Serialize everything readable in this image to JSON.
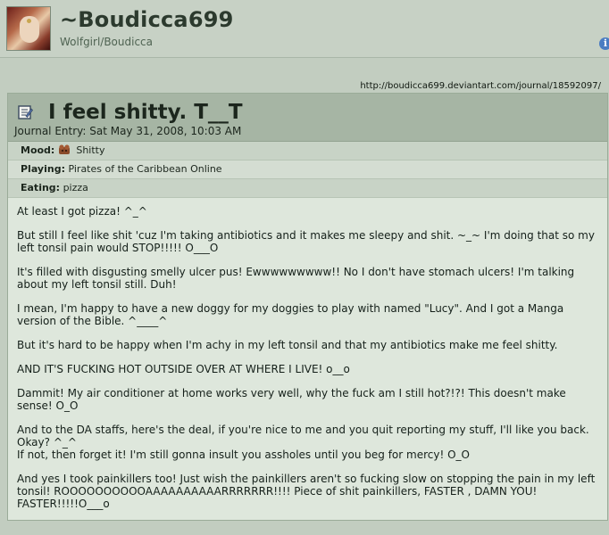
{
  "deviant": {
    "name": "~Boudicca699",
    "tagline": "Wolfgirl/Boudicca"
  },
  "journal": {
    "url": "http://boudicca699.deviantart.com/journal/18592097/",
    "title": "I feel shitty. T__T",
    "date": "Journal Entry: Sat May 31, 2008, 10:03 AM",
    "meta": {
      "mood_label": "Mood:",
      "mood_value": "Shitty",
      "playing_label": "Playing:",
      "playing_value": "Pirates of the Caribbean Online",
      "eating_label": "Eating:",
      "eating_value": "pizza"
    },
    "paragraphs": [
      "At least I got pizza! ^_^",
      "But still I feel like shit 'cuz I'm taking antibiotics and it makes me sleepy and shit. ~_~ I'm doing that so my left tonsil pain would STOP!!!!! O___O",
      "It's filled with disgusting smelly ulcer pus! Ewwwwwwwww!! No I don't have stomach ulcers! I'm talking about my left tonsil still. Duh!",
      "I mean, I'm happy to have a new doggy for my doggies to play with named \"Lucy\". And I got a Manga version of the Bible. ^____^",
      "But it's hard to be happy when I'm achy in my left tonsil and that my antibiotics make me feel shitty.",
      "AND IT'S FUCKING HOT OUTSIDE OVER AT WHERE I LIVE! o__o",
      "Dammit! My air conditioner at home works very well, why the fuck am I still hot?!?! This doesn't make sense! O_O",
      "And to the DA staffs, here's the deal, if you're nice to me and you quit reporting my stuff, I'll like you back. Okay? ^_^\nIf not, then forget it! I'm still gonna insult you assholes until you beg for mercy! O_O",
      "And yes I took painkillers too! Just wish the painkillers aren't so fucking slow on stopping the pain in my left tonsil! ROOOOOOOOOOAAAAAAAAAARRRRRRR!!!! Piece of shit painkillers, FASTER , DAMN YOU! FASTER!!!!!O___o"
    ]
  },
  "icons": {
    "avatar": "avatar",
    "info": "info-icon",
    "journal": "journal-icon",
    "mood": "mood-icon"
  },
  "colors": {
    "page_bg": "#c2cdc0",
    "panel_bg": "#dee7dc",
    "header_bg": "#a6b5a4"
  }
}
